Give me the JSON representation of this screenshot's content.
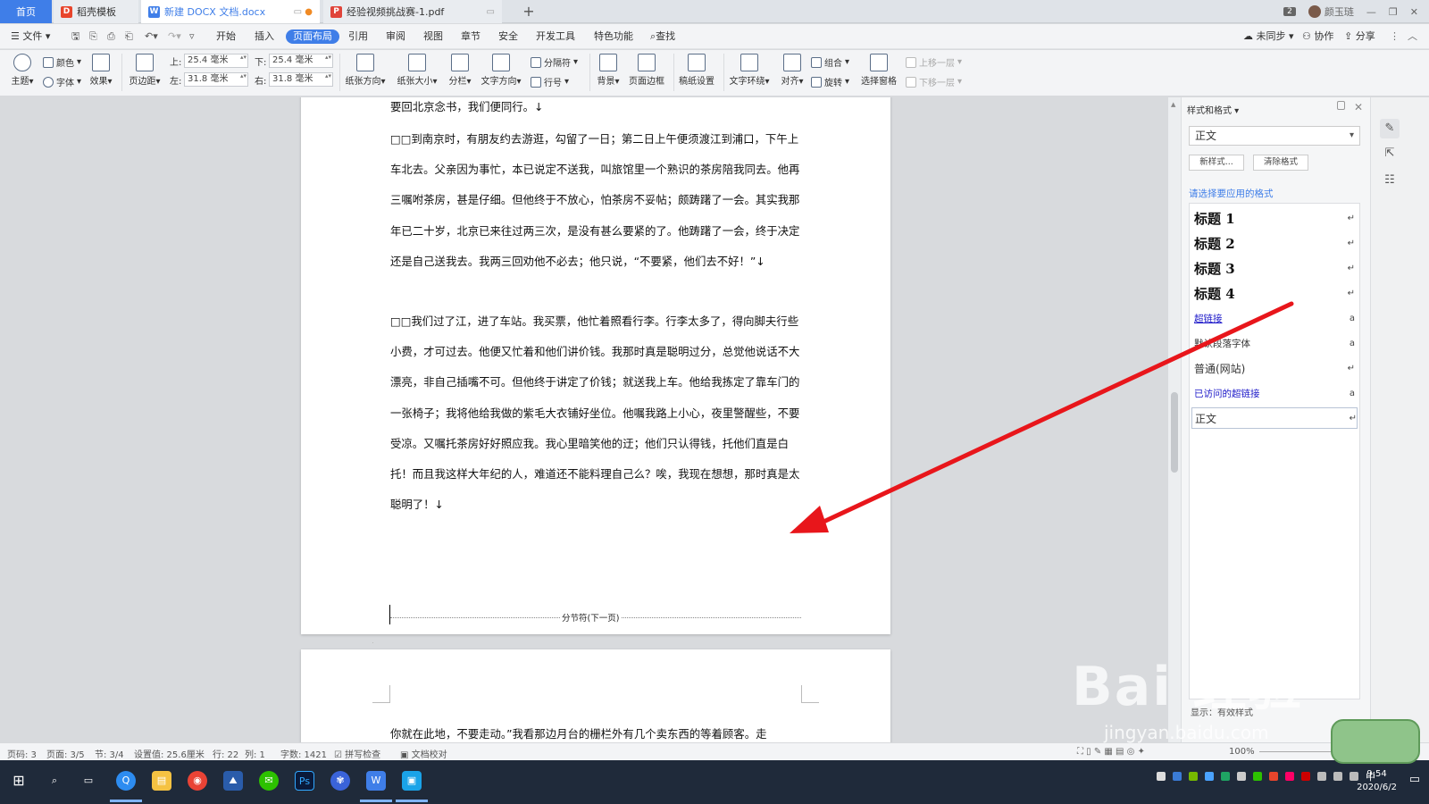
{
  "tabs": {
    "home": "首页",
    "templates": "稻壳模板",
    "doc": "新建 DOCX 文档.docx",
    "pdf": "经验视频挑战赛-1.pdf",
    "add": "+"
  },
  "window": {
    "badge": "2",
    "user": "颜玉琏"
  },
  "menu": {
    "file": "文件",
    "items": [
      "开始",
      "插入",
      "页面布局",
      "引用",
      "审阅",
      "视图",
      "章节",
      "安全",
      "开发工具",
      "特色功能"
    ],
    "active_index": 2,
    "search": "查找",
    "sync": "未同步",
    "collab": "协作",
    "share": "分享"
  },
  "ribbon": {
    "theme": "主题",
    "color": "颜色",
    "font": "字体",
    "effect": "效果",
    "margins": "页边距",
    "top_label": "上:",
    "top_value": "25.4 毫米",
    "bottom_label": "下:",
    "bottom_value": "25.4 毫米",
    "left_label": "左:",
    "left_value": "31.8 毫米",
    "right_label": "右:",
    "right_value": "31.8 毫米",
    "orientation": "纸张方向",
    "size": "纸张大小",
    "columns": "分栏",
    "text_direction": "文字方向",
    "breaks": "分隔符",
    "line_numbers": "行号",
    "background": "背景",
    "page_border": "页面边框",
    "manuscript": "稿纸设置",
    "wrap": "文字环绕",
    "align": "对齐",
    "group": "组合",
    "rotate": "旋转",
    "selection_pane": "选择窗格",
    "bring_forward": "上移一层",
    "send_backward": "下移一层"
  },
  "document": {
    "paragraphs": [
      "要回北京念书，我们便同行。↓",
      "□□到南京时，有朋友约去游逛，勾留了一日；第二日上午便须渡江到浦口，下午上车北去。父亲因为事忙，本已说定不送我，叫旅馆里一个熟识的茶房陪我同去。他再三嘱咐茶房，甚是仔细。但他终于不放心，怕茶房不妥帖；颇踌躇了一会。其实我那年已二十岁，北京已来往过两三次，是没有甚么要紧的了。他踌躇了一会，终于决定还是自己送我去。我两三回劝他不必去；他只说，“不要紧，他们去不好！”↓",
      "□□我们过了江，进了车站。我买票，他忙着照看行李。行李太多了，得向脚夫行些小费，才可过去。他便又忙着和他们讲价钱。我那时真是聪明过分，总觉他说话不大漂亮，非自己插嘴不可。但他终于讲定了价钱；就送我上车。他给我拣定了靠车门的一张椅子；我将他给我做的紫毛大衣铺好坐位。他嘱我路上小心，夜里警醒些，不要受凉。又嘱托茶房好好照应我。我心里暗笑他的迂；他们只认得钱，托他们直是白托！而且我这样大年纪的人，难道还不能料理自己么？唉，我现在想想，那时真是太聪明了！↓"
    ],
    "section_break": "分节符(下一页)",
    "page2_text": "你就在此地，不要走动。”我看那边月台的栅栏外有几个卖东西的等着顾客。走"
  },
  "panel": {
    "title": "样式和格式",
    "current_style": "正文",
    "new_style": "新样式...",
    "clear_format": "清除格式",
    "prompt": "请选择要应用的格式",
    "styles": [
      {
        "name": "标题  1",
        "kind": "heading",
        "mark": "↵"
      },
      {
        "name": "标题  2",
        "kind": "heading",
        "mark": "↵"
      },
      {
        "name": "标题  3",
        "kind": "heading",
        "mark": "↵"
      },
      {
        "name": "标题  4",
        "kind": "heading",
        "mark": "↵"
      },
      {
        "name": "超链接",
        "kind": "link",
        "mark": "a"
      },
      {
        "name": "默认段落字体",
        "kind": "small",
        "mark": "a"
      },
      {
        "name": "普通(网站)",
        "kind": "normal",
        "mark": "↵"
      },
      {
        "name": "已访问的超链接",
        "kind": "link",
        "mark": "a"
      },
      {
        "name": "正文",
        "kind": "normal",
        "mark": "↵"
      }
    ],
    "show": "显示：有效样式"
  },
  "status": {
    "page_code": "页码: 3",
    "page": "页面: 3/5",
    "section": "节: 3/4",
    "setting": "设置值: 25.6厘米",
    "row": "行: 22",
    "col": "列: 1",
    "words": "字数: 1421",
    "spell": "拼写检查",
    "proof": "文档校对",
    "zoom": "100%"
  },
  "taskbar": {
    "time": "9:54",
    "date": "2020/6/2",
    "ime": "中"
  },
  "watermark": {
    "brand": "Bai 经验",
    "url": "jingyan.baidu.com"
  },
  "colors": {
    "accent": "#3f7ee8",
    "arrow": "#e8161b",
    "link": "#1a16c8"
  }
}
